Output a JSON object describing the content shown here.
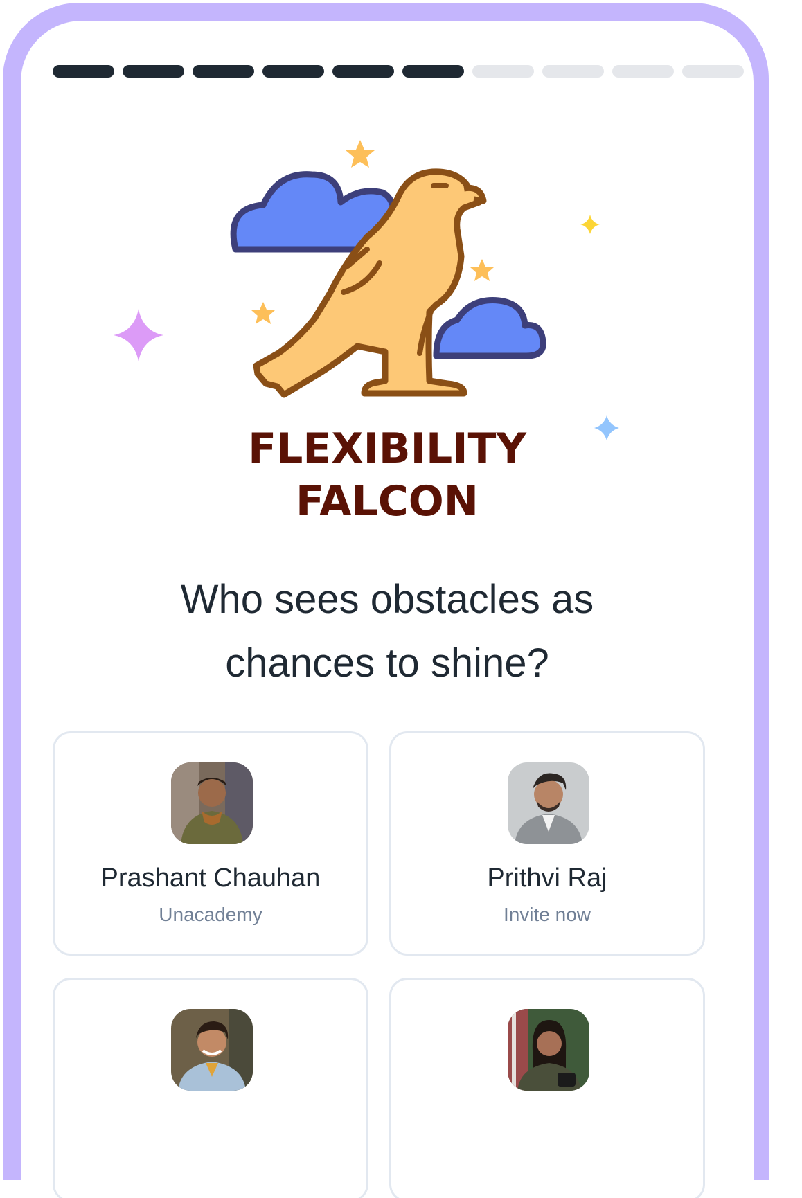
{
  "progress": {
    "total": 10,
    "completed": 6
  },
  "badge": {
    "icon": "falcon-icon",
    "title_line1": "FLEXIBILITY",
    "title_line2": "FALCON",
    "title_color": "#5a1205"
  },
  "question": {
    "line1": "Who sees obstacles as",
    "line2": "chances to shine?"
  },
  "people": [
    {
      "name": "Prashant Chauhan",
      "subtitle": "Unacademy"
    },
    {
      "name": "Prithvi Raj",
      "subtitle": "Invite now"
    },
    {
      "name": "",
      "subtitle": ""
    },
    {
      "name": "",
      "subtitle": ""
    }
  ],
  "colors": {
    "frame": "#c4b5fd",
    "progress_done": "#1f2933",
    "progress_todo": "#e5e7eb",
    "falcon": "#fdc876",
    "cloud": "#6488f7"
  }
}
